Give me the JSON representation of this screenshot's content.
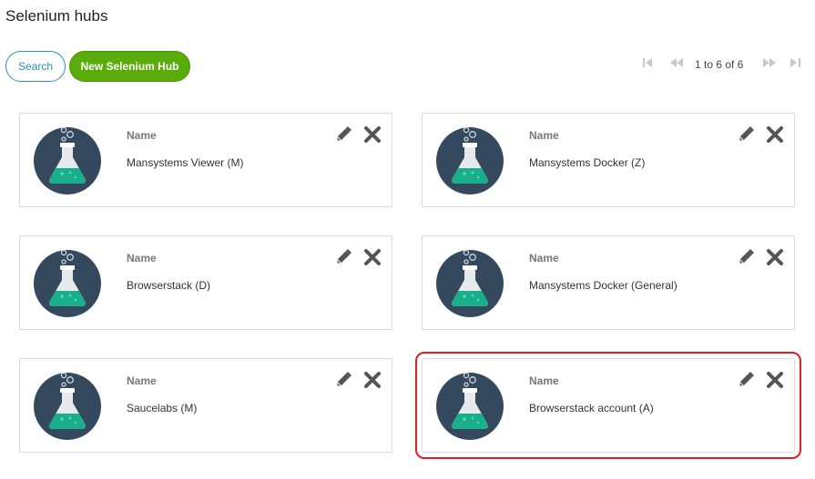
{
  "page": {
    "title": "Selenium hubs"
  },
  "toolbar": {
    "search_label": "Search",
    "new_hub_label": "New Selenium Hub"
  },
  "pagination": {
    "range_text": "1 to 6 of 6"
  },
  "hubs": [
    {
      "field_label": "Name",
      "name": "Mansystems Viewer (M)"
    },
    {
      "field_label": "Name",
      "name": "Mansystems Docker (Z)"
    },
    {
      "field_label": "Name",
      "name": "Browserstack (D)"
    },
    {
      "field_label": "Name",
      "name": "Mansystems Docker (General)"
    },
    {
      "field_label": "Name",
      "name": "Saucelabs (M)"
    },
    {
      "field_label": "Name",
      "name": "Browserstack account (A)",
      "selected": true
    }
  ],
  "icons": {
    "hub_avatar": "flask-icon",
    "edit": "pencil-icon",
    "delete": "close-icon",
    "first": "first-page-icon",
    "prev": "previous-page-icon",
    "next": "next-page-icon",
    "last": "last-page-icon"
  },
  "colors": {
    "primary_button": "#5aac0a",
    "search_border": "#2a8fbd",
    "avatar_bg": "#34495e",
    "flask_liquid": "#1aaf8b",
    "selection_outline": "#e02020"
  }
}
